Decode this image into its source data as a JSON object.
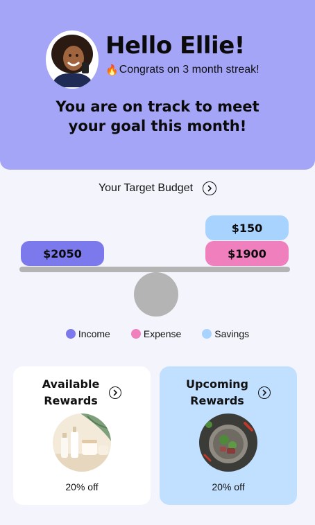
{
  "header": {
    "greeting": "Hello Ellie!",
    "streak_text": "Congrats on 3 month streak!",
    "streak_icon": "flame-icon",
    "status_line1": "You are on track to meet",
    "status_line2": "your goal this month!",
    "background": "#a4a5f6"
  },
  "budget": {
    "label": "Your Target Budget",
    "income": "$2050",
    "savings": "$150",
    "expense": "$1900"
  },
  "legend": [
    {
      "label": "Income",
      "color": "#7b79ec"
    },
    {
      "label": "Expense",
      "color": "#f07fbd"
    },
    {
      "label": "Savings",
      "color": "#a9d3ff"
    }
  ],
  "cards": {
    "available": {
      "title_line1": "Available",
      "title_line2": "Rewards",
      "offer": "20% off"
    },
    "upcoming": {
      "title_line1": "Upcoming",
      "title_line2": "Rewards",
      "offer": "20% off"
    }
  }
}
